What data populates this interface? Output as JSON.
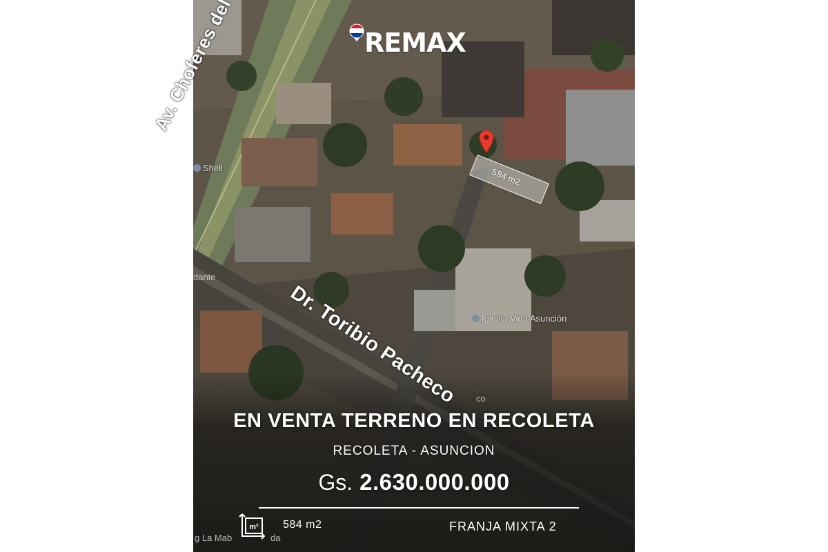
{
  "brand": {
    "name": "REMAX",
    "balloon_colors": [
      "#dc1c2e",
      "#ffffff",
      "#003da5"
    ]
  },
  "map": {
    "streets": {
      "main_avenue": "Av. Choferes del Chaco",
      "side_street": "Dr. Toribio Pacheco"
    },
    "points_of_interest": {
      "fuel_station": "Shell",
      "church": "Iglesia Vida Asunción",
      "edge_label": "dante",
      "bottom_label_a": "g La Mab",
      "bottom_label_b": "da",
      "street_ghost": "co"
    },
    "plot": {
      "area_label": "584 m2",
      "pin_color": "#e8392c"
    }
  },
  "listing": {
    "title": "EN VENTA TERRENO EN RECOLETA",
    "location": "RECOLETA - ASUNCION",
    "price_currency": "Gs.",
    "price_value": "2.630.000.000",
    "area_icon_label": "m²",
    "area": "584 m2",
    "zoning": "FRANJA MIXTA 2"
  }
}
